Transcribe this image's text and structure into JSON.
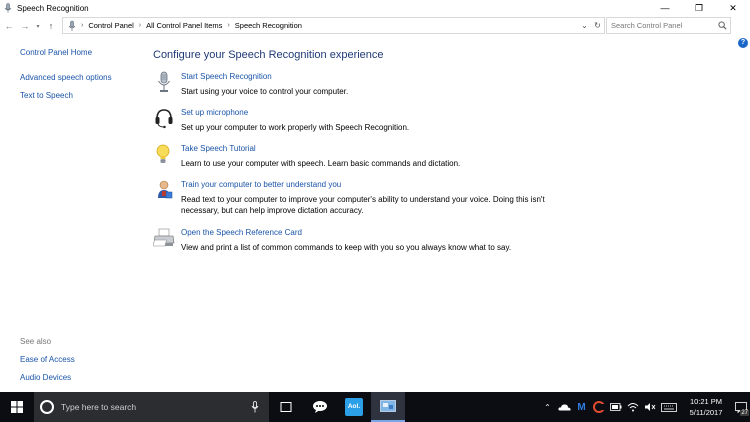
{
  "window": {
    "title": "Speech Recognition",
    "controls": {
      "minimize": "—",
      "restore": "❐",
      "close": "✕"
    }
  },
  "address_bar": {
    "crumbs": [
      "Control Panel",
      "All Control Panel Items",
      "Speech Recognition"
    ],
    "search_placeholder": "Search Control Panel"
  },
  "left_pane": {
    "home": "Control Panel Home",
    "links": [
      "Advanced speech options",
      "Text to Speech"
    ],
    "see_also_label": "See also",
    "see_also_links": [
      "Ease of Access",
      "Audio Devices"
    ]
  },
  "main": {
    "title": "Configure your Speech Recognition experience",
    "tasks": [
      {
        "link": "Start Speech Recognition",
        "desc": "Start using your voice to control your computer.",
        "icon": "microphone-icon"
      },
      {
        "link": "Set up microphone",
        "desc": "Set up your computer to work properly with Speech Recognition.",
        "icon": "headset-icon"
      },
      {
        "link": "Take Speech Tutorial",
        "desc": "Learn to use your computer with speech.  Learn basic commands and dictation.",
        "icon": "lightbulb-icon"
      },
      {
        "link": "Train your computer to better understand you",
        "desc": "Read text to your computer to improve your computer's ability to understand your voice.  Doing this isn't necessary, but can help improve dictation accuracy.",
        "icon": "user-train-icon"
      },
      {
        "link": "Open the Speech Reference Card",
        "desc": "View and print a list of common commands to keep with you so you always know what to say.",
        "icon": "printer-icon"
      }
    ]
  },
  "taskbar": {
    "search_text": "Type here to search",
    "clock_time": "10:21 PM",
    "clock_date": "5/11/2017",
    "notification_count": "27",
    "app_aol": "Aol."
  },
  "colors": {
    "link": "#1a54a8",
    "title": "#1f3a78",
    "taskbar": "#0b0d12"
  }
}
